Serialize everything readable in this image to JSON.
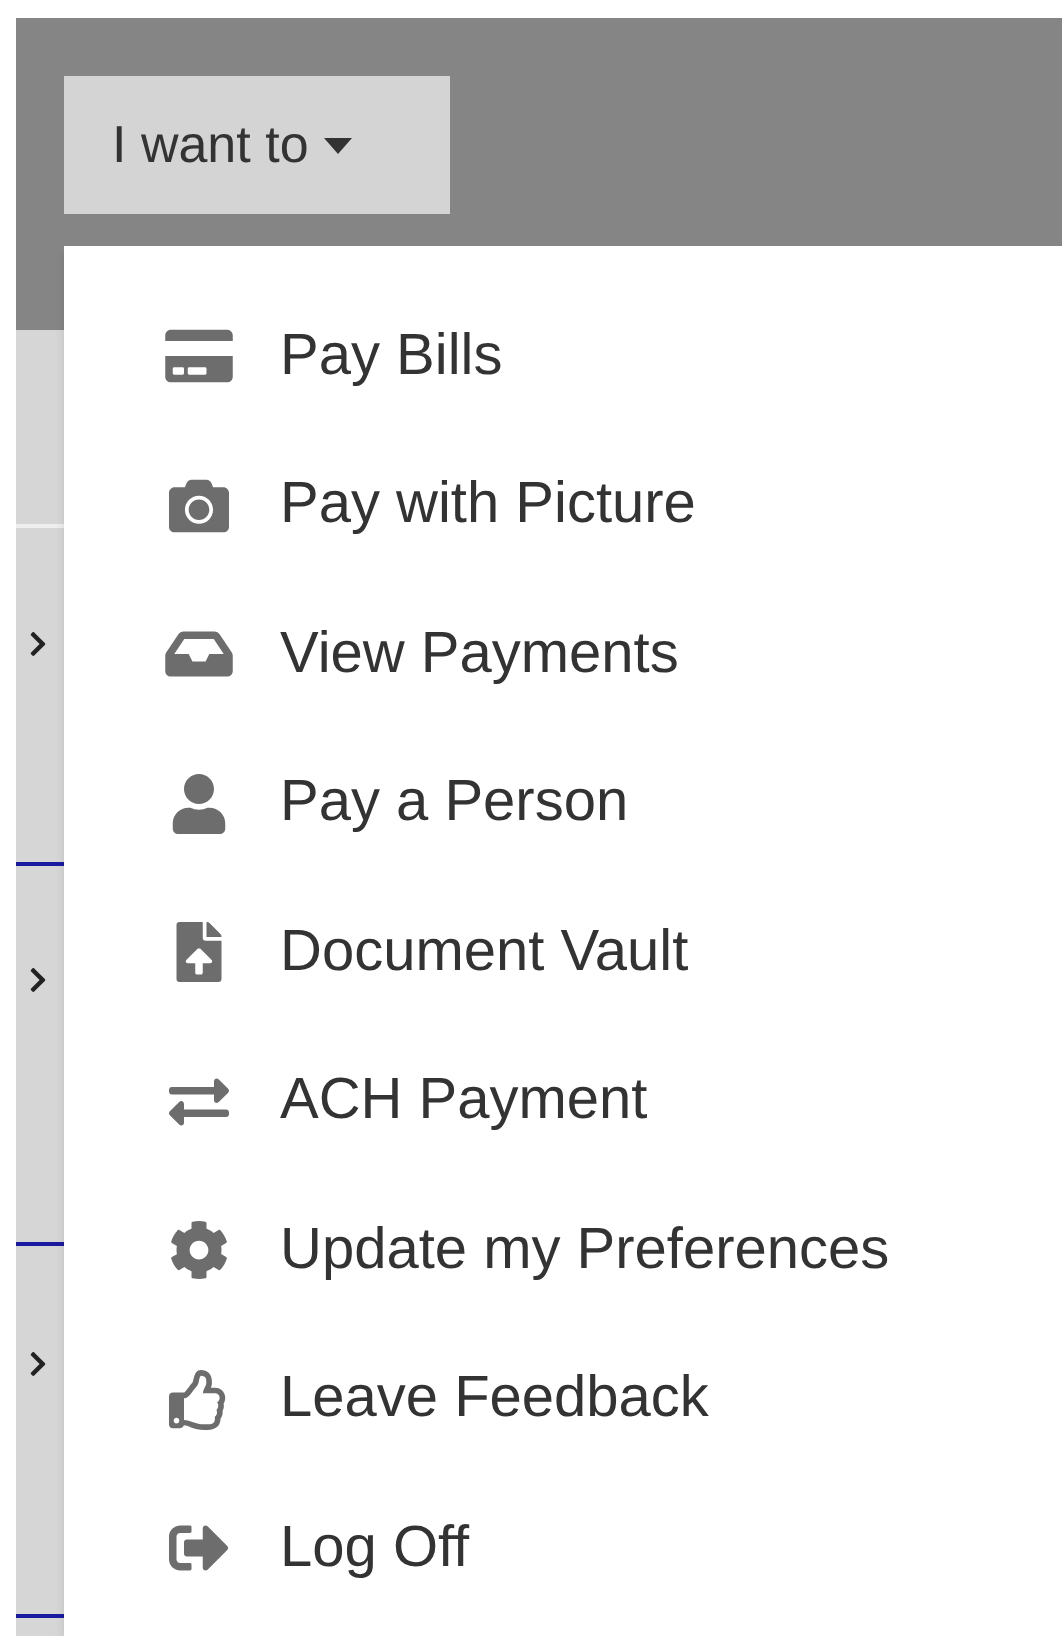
{
  "dropdown_button": {
    "label": "I want to",
    "expanded": true
  },
  "menu": {
    "items": [
      {
        "label": "Pay Bills"
      },
      {
        "label": "Pay with Picture"
      },
      {
        "label": "View Payments"
      },
      {
        "label": "Pay a Person"
      },
      {
        "label": "Document Vault"
      },
      {
        "label": "ACH Payment"
      },
      {
        "label": "Update my Preferences"
      },
      {
        "label": "Leave Feedback"
      },
      {
        "label": "Log Off"
      }
    ]
  }
}
